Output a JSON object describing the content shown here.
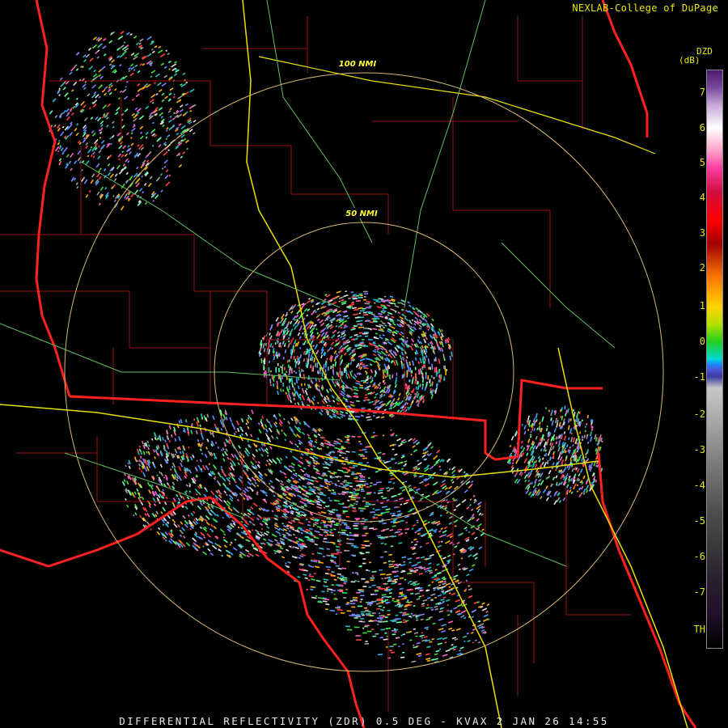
{
  "credit": "NEXLAB-College of DuPage",
  "legend": {
    "product": "DZD",
    "units": "(dB)",
    "ticks": [
      "7",
      "6",
      "5",
      "4",
      "3",
      "2",
      "1",
      "0",
      "-1",
      "-2",
      "-3",
      "-4",
      "-5",
      "-6",
      "-7",
      "TH"
    ]
  },
  "rings": [
    {
      "label": "100 NMI"
    },
    {
      "label": "50 NMI"
    }
  ],
  "caption": "DIFFERENTIAL REFLECTIVITY (ZDR) 0.5 DEG - KVAX 2 JAN 26 14:55"
}
